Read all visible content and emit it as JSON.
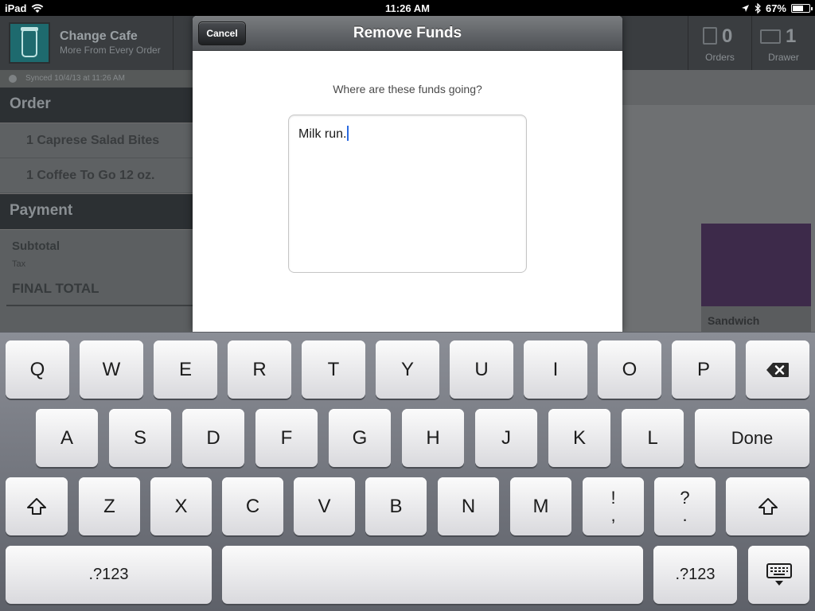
{
  "status_bar": {
    "device": "iPad",
    "time": "11:26 AM",
    "battery": "67%",
    "battery_level": 0.67
  },
  "header": {
    "app_name": "Change Cafe",
    "tagline": "More From Every Order",
    "orders": {
      "count": "0",
      "label": "Orders"
    },
    "drawer": {
      "count": "1",
      "label": "Drawer"
    }
  },
  "sync": {
    "text": "Synced 10/4/13 at 11:26 AM"
  },
  "order": {
    "title": "Order",
    "items": [
      {
        "text": "1 Caprese Salad Bites"
      },
      {
        "text": "1 Coffee To Go 12 oz."
      }
    ]
  },
  "payment": {
    "title": "Payment",
    "subtotal": "Subtotal",
    "tax": "Tax",
    "final_total": "FINAL TOTAL"
  },
  "menu_tiles": [
    {
      "label": "Sandwich",
      "color": "#3d2a4a"
    }
  ],
  "modal": {
    "title": "Remove Funds",
    "cancel_label": "Cancel",
    "prompt": "Where are these funds going?",
    "text_value": "Milk run."
  },
  "keyboard": {
    "row1": [
      "Q",
      "W",
      "E",
      "R",
      "T",
      "Y",
      "U",
      "I",
      "O",
      "P"
    ],
    "row2": [
      "A",
      "S",
      "D",
      "F",
      "G",
      "H",
      "J",
      "K",
      "L"
    ],
    "row3": [
      "Z",
      "X",
      "C",
      "V",
      "B",
      "N",
      "M"
    ],
    "done_label": "Done",
    "excl_top": "!",
    "excl_bottom": ",",
    "quest_top": "?",
    "quest_bottom": ".",
    "numbers_label": ".?123",
    "icons": {
      "delete": "backspace-icon",
      "shift": "shift-icon",
      "dismiss": "keyboard-dismiss-icon"
    }
  }
}
